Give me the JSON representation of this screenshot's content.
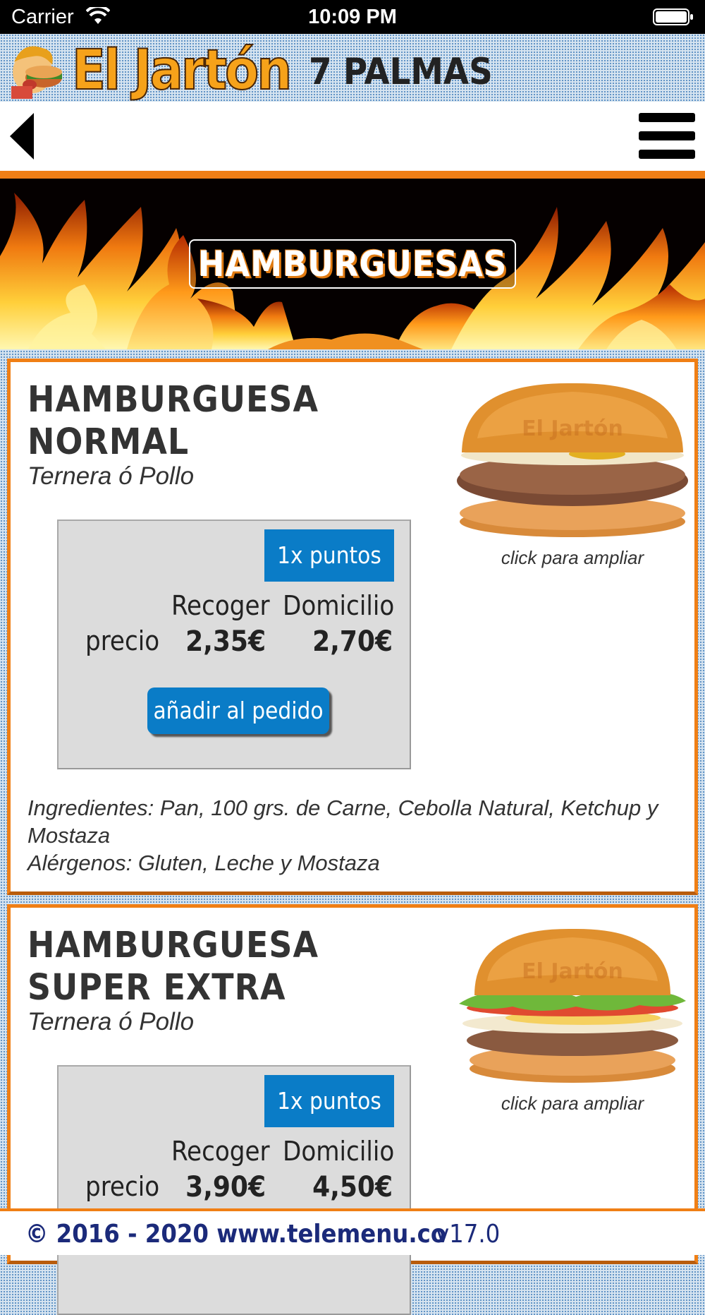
{
  "status_bar": {
    "carrier": "Carrier",
    "time": "10:09 PM"
  },
  "brand": {
    "name": "El Jartón",
    "location": "7 PALMAS",
    "accent_color": "#f07f15",
    "brand_color": "#f6a21a"
  },
  "category": {
    "title": "HAMBURGUESAS"
  },
  "products": [
    {
      "name": "HAMBURGUESA NORMAL",
      "subtitle": "Ternera ó Pollo",
      "zoom_hint": "click para ampliar",
      "points": "1x puntos",
      "col_pickup": "Recoger",
      "col_delivery": "Domicilio",
      "row_label": "precio",
      "price_pickup": "2,35€",
      "price_delivery": "2,70€",
      "add_label": "añadir al pedido",
      "ingredients": "Ingredientes: Pan, 100 grs. de Carne, Cebolla Natural, Ketchup y Mostaza",
      "allergens": "Alérgenos: Gluten, Leche y Mostaza"
    },
    {
      "name": "HAMBURGUESA SUPER EXTRA",
      "subtitle": "Ternera ó Pollo",
      "zoom_hint": "click para ampliar",
      "points": "1x puntos",
      "col_pickup": "Recoger",
      "col_delivery": "Domicilio",
      "row_label": "precio",
      "price_pickup": "3,90€",
      "price_delivery": "4,50€"
    }
  ],
  "footer": {
    "copyright": "© 2016 - 2020 www.telemenu.co",
    "version": "v17.0"
  },
  "icons": [
    "wifi-icon",
    "battery-icon",
    "mascot-logo",
    "back-icon",
    "menu-icon",
    "flames-background",
    "burger-image"
  ],
  "colors": {
    "button_blue": "#0a7cc7",
    "footer_text": "#1b2a7a"
  }
}
